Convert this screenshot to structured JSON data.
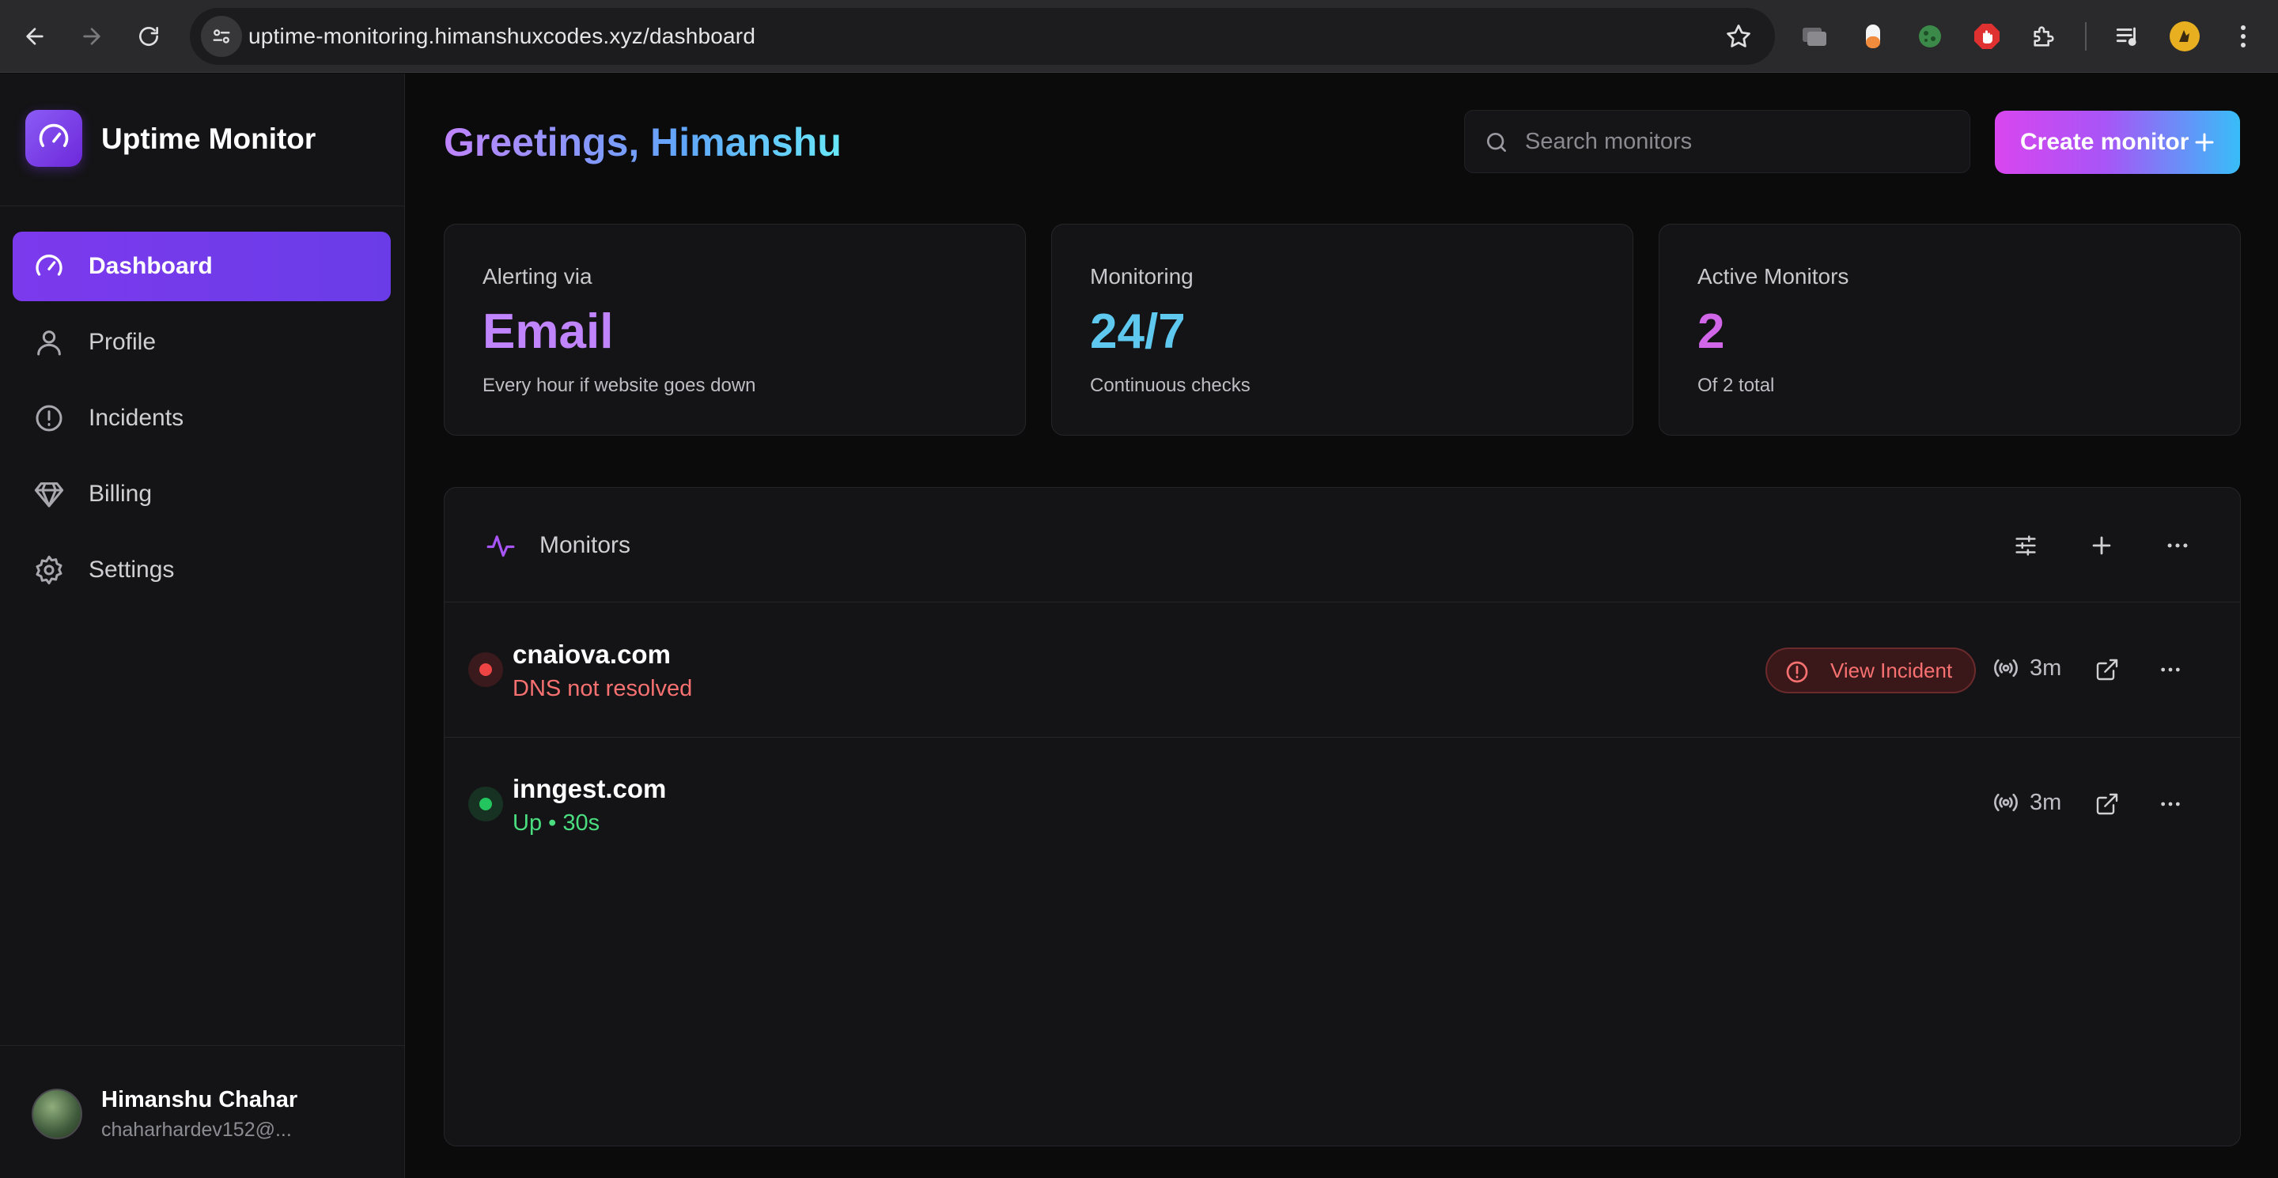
{
  "browser": {
    "url": "uptime-monitoring.himanshuxcodes.xyz/dashboard"
  },
  "sidebar": {
    "brand": "Uptime Monitor",
    "items": [
      {
        "label": "Dashboard",
        "icon": "gauge-icon",
        "active": true
      },
      {
        "label": "Profile",
        "icon": "user-icon",
        "active": false
      },
      {
        "label": "Incidents",
        "icon": "alert-circle-icon",
        "active": false
      },
      {
        "label": "Billing",
        "icon": "diamond-icon",
        "active": false
      },
      {
        "label": "Settings",
        "icon": "gear-icon",
        "active": false
      }
    ],
    "user": {
      "name": "Himanshu Chahar",
      "email": "chaharhardev152@..."
    }
  },
  "header": {
    "greeting": "Greetings, Himanshu",
    "search_placeholder": "Search monitors",
    "create_label": "Create monitor"
  },
  "stats": [
    {
      "caption": "Alerting via",
      "value": "Email",
      "sub": "Every hour if website goes down",
      "color": "#c084fc"
    },
    {
      "caption": "Monitoring",
      "value": "24/7",
      "sub": "Continuous checks",
      "color": "#5ec8ee"
    },
    {
      "caption": "Active Monitors",
      "value": "2",
      "sub": "Of 2 total",
      "color": "#d167e8"
    }
  ],
  "monitors_panel": {
    "title": "Monitors",
    "rows": [
      {
        "name": "cnaiova.com",
        "status": "DNS not resolved",
        "state": "down",
        "interval": "3m",
        "incident_label": "View Incident",
        "status_color": "#f87171"
      },
      {
        "name": "inngest.com",
        "status": "Up • 30s",
        "state": "up",
        "interval": "3m",
        "status_color": "#4ade80"
      }
    ]
  },
  "colors": {
    "accent": "#7c3aed",
    "down": "#ef4444",
    "up": "#22c55e"
  }
}
